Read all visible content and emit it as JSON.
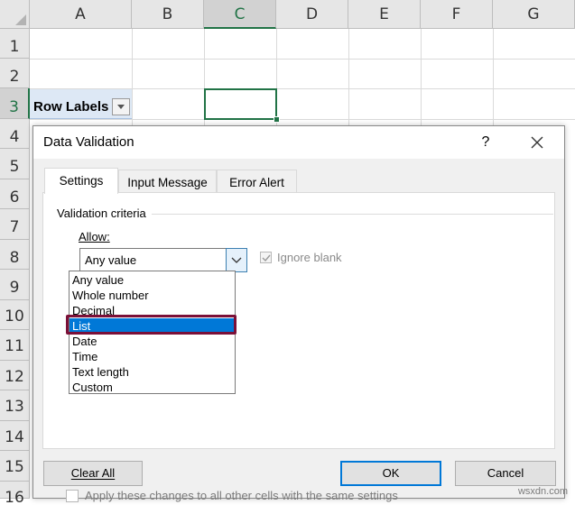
{
  "sheet": {
    "columns": [
      "A",
      "B",
      "C",
      "D",
      "E",
      "F",
      "G"
    ],
    "selected_column": "C",
    "rows": [
      "1",
      "2",
      "3",
      "4",
      "5",
      "6",
      "7",
      "8",
      "9",
      "10",
      "11",
      "12",
      "13",
      "14",
      "15",
      "16"
    ],
    "selected_row": "3",
    "cell_a3": "Row Labels"
  },
  "dialog": {
    "title": "Data Validation",
    "help": "?",
    "tabs": [
      "Settings",
      "Input Message",
      "Error Alert"
    ],
    "active_tab": "Settings",
    "group_label": "Validation criteria",
    "allow_label": "Allow:",
    "allow_value": "Any value",
    "ignore_blank": {
      "label": "Ignore blank",
      "checked": true,
      "enabled": false
    },
    "allow_options": [
      "Any value",
      "Whole number",
      "Decimal",
      "List",
      "Date",
      "Time",
      "Text length",
      "Custom"
    ],
    "highlighted_option": "List",
    "apply_label": "Apply these changes to all other cells with the same settings",
    "buttons": {
      "clear_all": "Clear All",
      "ok": "OK",
      "cancel": "Cancel"
    }
  },
  "watermark": "wsxdn.com",
  "colors": {
    "excel_green": "#217346",
    "accent_blue": "#0078d7",
    "highlight_border": "#7b1038"
  }
}
